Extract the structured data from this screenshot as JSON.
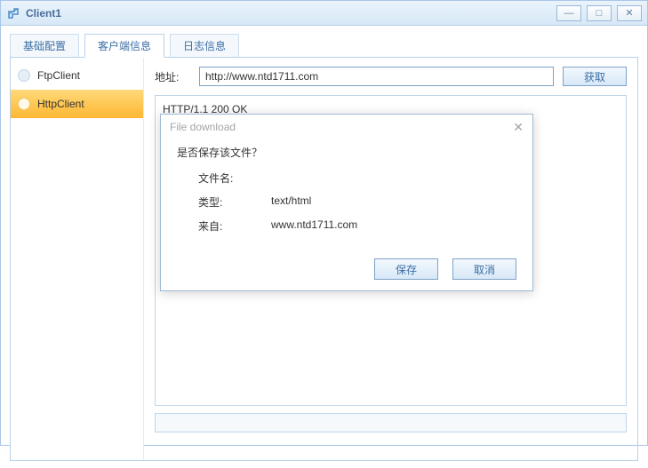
{
  "window": {
    "title": "Client1"
  },
  "tabs": [
    {
      "label": "基础配置"
    },
    {
      "label": "客户端信息"
    },
    {
      "label": "日志信息"
    }
  ],
  "sidebar": {
    "items": [
      {
        "label": "FtpClient"
      },
      {
        "label": "HttpClient"
      }
    ]
  },
  "addr": {
    "label": "地址:",
    "value": "http://www.ntd1711.com",
    "fetch": "获取"
  },
  "response": "HTTP/1.1 200 OK",
  "dialog": {
    "title": "File download",
    "question": "是否保存该文件？",
    "filename_label": "文件名:",
    "filename_value": "",
    "type_label": "类型:",
    "type_value": "text/html",
    "from_label": "来自:",
    "from_value": "www.ntd1711.com",
    "save": "保存",
    "cancel": "取消"
  }
}
